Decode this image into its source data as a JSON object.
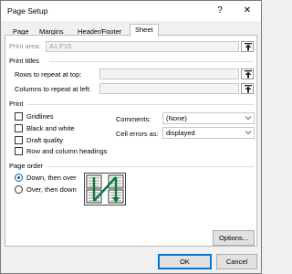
{
  "window": {
    "title": "Page Setup",
    "help": "?",
    "close": "✕"
  },
  "tabs": [
    {
      "label": "Page"
    },
    {
      "label": "Margins"
    },
    {
      "label": "Header/Footer"
    },
    {
      "label": "Sheet"
    }
  ],
  "print_area": {
    "label": "Print area:",
    "value": "A1:F15"
  },
  "print_titles": {
    "heading": "Print titles",
    "rows_label": "Rows to repeat at top:",
    "rows_value": "",
    "cols_label": "Columns to repeat at left:",
    "cols_value": ""
  },
  "print": {
    "heading": "Print",
    "gridlines": {
      "label": "Gridlines",
      "checked": false
    },
    "black_white": {
      "label": "Black and white",
      "checked": false
    },
    "draft": {
      "label": "Draft quality",
      "checked": false
    },
    "row_col_headings": {
      "label": "Row and column headings",
      "checked": false
    },
    "comments_label": "Comments:",
    "comments_value": "(None)",
    "errors_label": "Cell errors as:",
    "errors_value": "displayed"
  },
  "page_order": {
    "heading": "Page order",
    "down_over": {
      "label": "Down, then over",
      "selected": true
    },
    "over_down": {
      "label": "Over, then down",
      "selected": false
    }
  },
  "buttons": {
    "options": "Options...",
    "ok": "OK",
    "cancel": "Cancel"
  }
}
